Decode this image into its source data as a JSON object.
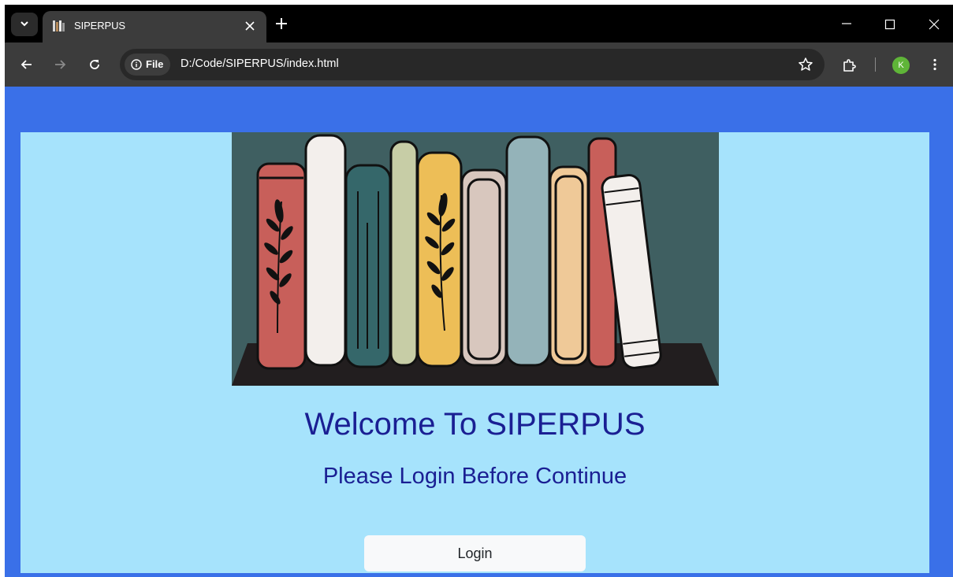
{
  "browser": {
    "tab": {
      "title": "SIPERPUS",
      "favicon": "books-icon"
    },
    "address": {
      "chip_label": "File",
      "url": "D:/Code/SIPERPUS/index.html"
    },
    "profile_initial": "K",
    "colors": {
      "tabbar": "#000000",
      "toolbar": "#3c3c3c",
      "avatar": "#5fb538"
    }
  },
  "page": {
    "colors": {
      "outer": "#3a70e8",
      "panel": "#a6e3fc",
      "heading": "#1a1f93"
    },
    "hero_image": "bookshelf-illustration",
    "welcome": "Welcome To SIPERPUS",
    "subtitle": "Please Login Before Continue",
    "login_label": "Login"
  }
}
